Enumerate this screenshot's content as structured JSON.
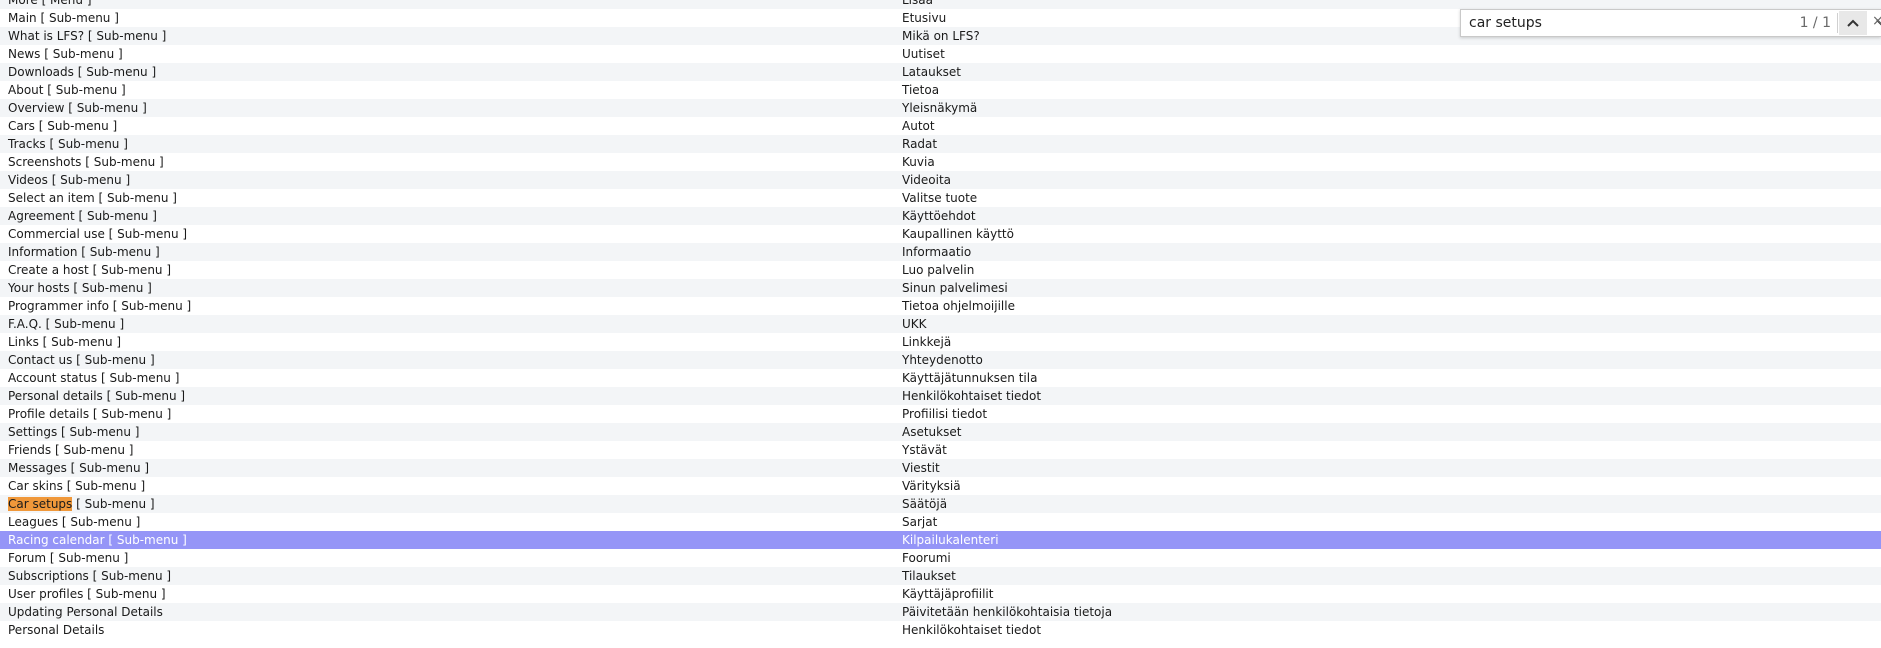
{
  "find_bar": {
    "query": "car setups",
    "match_count": "1 / 1",
    "close_glyph": "×"
  },
  "rows": [
    {
      "en": "More [ Menu ]",
      "fi": "Lisää"
    },
    {
      "en": "Main [ Sub-menu ]",
      "fi": "Etusivu"
    },
    {
      "en": "What is LFS? [ Sub-menu ]",
      "fi": "Mikä on LFS?"
    },
    {
      "en": "News [ Sub-menu ]",
      "fi": "Uutiset"
    },
    {
      "en": "Downloads [ Sub-menu ]",
      "fi": "Lataukset"
    },
    {
      "en": "About [ Sub-menu ]",
      "fi": "Tietoa"
    },
    {
      "en": "Overview [ Sub-menu ]",
      "fi": "Yleisnäkymä"
    },
    {
      "en": "Cars [ Sub-menu ]",
      "fi": "Autot"
    },
    {
      "en": "Tracks [ Sub-menu ]",
      "fi": "Radat"
    },
    {
      "en": "Screenshots [ Sub-menu ]",
      "fi": "Kuvia"
    },
    {
      "en": "Videos [ Sub-menu ]",
      "fi": "Videoita"
    },
    {
      "en": "Select an item [ Sub-menu ]",
      "fi": "Valitse tuote"
    },
    {
      "en": "Agreement [ Sub-menu ]",
      "fi": "Käyttöehdot"
    },
    {
      "en": "Commercial use [ Sub-menu ]",
      "fi": "Kaupallinen käyttö"
    },
    {
      "en": "Information [ Sub-menu ]",
      "fi": "Informaatio"
    },
    {
      "en": "Create a host [ Sub-menu ]",
      "fi": "Luo palvelin"
    },
    {
      "en": "Your hosts [ Sub-menu ]",
      "fi": "Sinun palvelimesi"
    },
    {
      "en": "Programmer info [ Sub-menu ]",
      "fi": "Tietoa ohjelmoijille"
    },
    {
      "en": "F.A.Q. [ Sub-menu ]",
      "fi": "UKK"
    },
    {
      "en": "Links [ Sub-menu ]",
      "fi": "Linkkejä"
    },
    {
      "en": "Contact us [ Sub-menu ]",
      "fi": "Yhteydenotto"
    },
    {
      "en": "Account status [ Sub-menu ]",
      "fi": "Käyttäjätunnuksen tila"
    },
    {
      "en": "Personal details [ Sub-menu ]",
      "fi": "Henkilökohtaiset tiedot"
    },
    {
      "en": "Profile details [ Sub-menu ]",
      "fi": "Profiilisi tiedot"
    },
    {
      "en": "Settings [ Sub-menu ]",
      "fi": "Asetukset"
    },
    {
      "en": "Friends [ Sub-menu ]",
      "fi": "Ystävät"
    },
    {
      "en": "Messages [ Sub-menu ]",
      "fi": "Viestit"
    },
    {
      "en": "Car skins [ Sub-menu ]",
      "fi": "Värityksiä"
    },
    {
      "en": "Car setups [ Sub-menu ]",
      "fi": "Säätöjä",
      "highlight": "Car setups"
    },
    {
      "en": "Leagues [ Sub-menu ]",
      "fi": "Sarjat"
    },
    {
      "en": "Racing calendar [ Sub-menu ]",
      "fi": "Kilpailukalenteri",
      "selected": true
    },
    {
      "en": "Forum [ Sub-menu ]",
      "fi": "Foorumi"
    },
    {
      "en": "Subscriptions [ Sub-menu ]",
      "fi": "Tilaukset"
    },
    {
      "en": "User profiles [ Sub-menu ]",
      "fi": "Käyttäjäprofiilit"
    },
    {
      "en": "Updating Personal Details",
      "fi": "Päivitetään henkilökohtaisia tietoja"
    },
    {
      "en": "Personal Details",
      "fi": "Henkilökohtaiset tiedot"
    }
  ],
  "colors": {
    "row_alt": "#f3f5f7",
    "selected_row": "#9595f7",
    "search_highlight": "#f0983a"
  },
  "icons": {
    "find_prev": "chevron-up-icon",
    "find_next": "chevron-down-icon",
    "find_close": "close-icon"
  }
}
